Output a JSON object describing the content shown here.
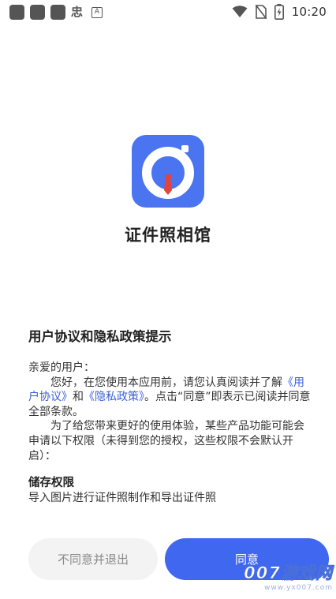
{
  "status_bar": {
    "left_glyph": "忠",
    "left_badge": "A",
    "time": "10:20",
    "icons": [
      "notification-square-icon",
      "notification-square-icon",
      "notification-square-icon",
      "wifi-icon",
      "no-sim-icon",
      "battery-charging-icon"
    ]
  },
  "app": {
    "name": "证件照相馆",
    "logo_icon": "camera-aperture-icon"
  },
  "policy": {
    "title": "用户协议和隐私政策提示",
    "greeting": "亲爱的用户：",
    "p1_start": "您好，在您使用本应用前，请您认真阅读并了解",
    "user_agreement_link": "《用户协议》",
    "p1_and": "和",
    "privacy_link": "《隐私政策》",
    "p1_end": "。点击“同意”即表示已阅读并同意全部条款。",
    "p2": "为了给您带来更好的使用体验，某些产品功能可能会申请以下权限（未得到您的授权，这些权限不会默认开启）：",
    "storage_title": "储存权限",
    "storage_desc": "导入图片进行证件照制作和导出证件照"
  },
  "buttons": {
    "decline": "不同意并退出",
    "agree": "同意"
  },
  "colors": {
    "accent": "#3f67ef",
    "logo_bg": "#4a74f0",
    "link": "#3a5fd8",
    "decline_bg": "#f3f3f3",
    "tie": "#e0443a"
  },
  "watermark": {
    "main": "007游戏网",
    "sub": "www.yx007.com"
  }
}
